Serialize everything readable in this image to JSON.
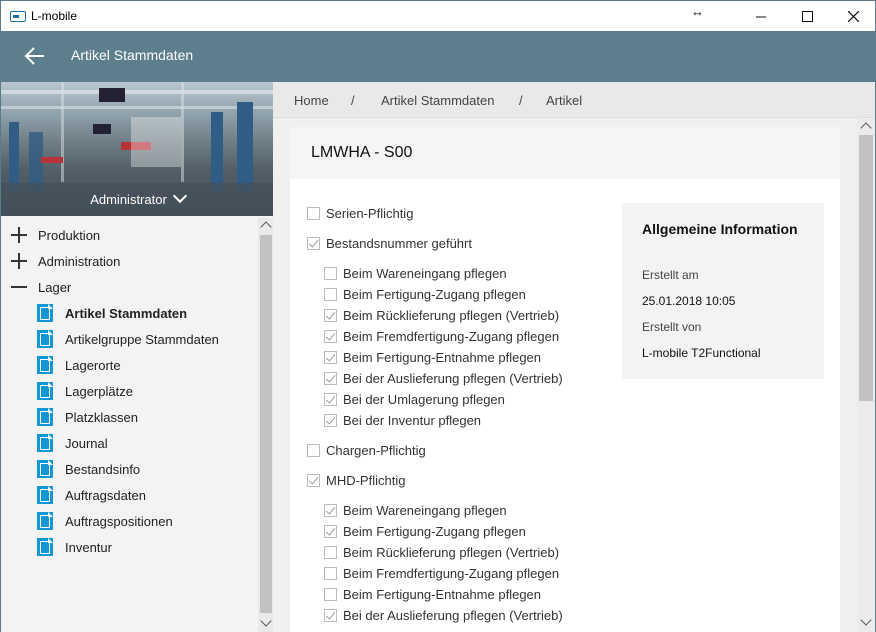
{
  "window": {
    "title": "L-mobile",
    "resize_glyph": "↔",
    "minimize_glyph": "—",
    "maximize_glyph": "☐",
    "close_glyph": "✕"
  },
  "header": {
    "title": "Artikel Stammdaten"
  },
  "sidebar": {
    "user_role": "Administrator",
    "groups": [
      {
        "label": "Produktion",
        "expanded": false
      },
      {
        "label": "Administration",
        "expanded": false
      },
      {
        "label": "Lager",
        "expanded": true
      }
    ],
    "items": [
      {
        "label": "Artikel Stammdaten",
        "active": true
      },
      {
        "label": "Artikelgruppe Stammdaten",
        "active": false
      },
      {
        "label": "Lagerorte",
        "active": false
      },
      {
        "label": "Lagerplätze",
        "active": false
      },
      {
        "label": "Platzklassen",
        "active": false
      },
      {
        "label": "Journal",
        "active": false
      },
      {
        "label": "Bestandsinfo",
        "active": false
      },
      {
        "label": "Auftragsdaten",
        "active": false
      },
      {
        "label": "Auftragspositionen",
        "active": false
      },
      {
        "label": "Inventur",
        "active": false
      }
    ]
  },
  "breadcrumb": {
    "items": [
      "Home",
      "Artikel Stammdaten",
      "Artikel"
    ],
    "separator": "/"
  },
  "card": {
    "title": "LMWHA - S00"
  },
  "checks": [
    {
      "label": "Serien-Pflichtig",
      "checked": false
    },
    {
      "label": "Bestandsnummer geführt",
      "checked": true
    },
    {
      "label": "Beim Wareneingang pflegen",
      "checked": false
    },
    {
      "label": "Beim Fertigung-Zugang pflegen",
      "checked": false
    },
    {
      "label": "Beim Rücklieferung pflegen (Vertrieb)",
      "checked": true
    },
    {
      "label": "Beim Fremdfertigung-Zugang pflegen",
      "checked": true
    },
    {
      "label": "Beim Fertigung-Entnahme pflegen",
      "checked": true
    },
    {
      "label": "Bei der Auslieferung pflegen (Vertrieb)",
      "checked": true
    },
    {
      "label": "Bei der Umlagerung pflegen",
      "checked": true
    },
    {
      "label": "Bei der Inventur pflegen",
      "checked": true
    },
    {
      "label": "Chargen-Pflichtig",
      "checked": false
    },
    {
      "label": "MHD-Pflichtig",
      "checked": true
    },
    {
      "label": "Beim Wareneingang pflegen",
      "checked": true
    },
    {
      "label": "Beim Fertigung-Zugang pflegen",
      "checked": true
    },
    {
      "label": "Beim Rücklieferung pflegen (Vertrieb)",
      "checked": false
    },
    {
      "label": "Beim Fremdfertigung-Zugang pflegen",
      "checked": false
    },
    {
      "label": "Beim Fertigung-Entnahme pflegen",
      "checked": false
    },
    {
      "label": "Bei der Auslieferung pflegen (Vertrieb)",
      "checked": true
    }
  ],
  "info": {
    "title": "Allgemeine Information",
    "created_at_label": "Erstellt am",
    "created_at_value": "25.01.2018 10:05",
    "created_by_label": "Erstellt von",
    "created_by_value": "L-mobile T2Functional"
  },
  "colors": {
    "appbar": "#5d7e8c",
    "accent": "#1296d4"
  }
}
